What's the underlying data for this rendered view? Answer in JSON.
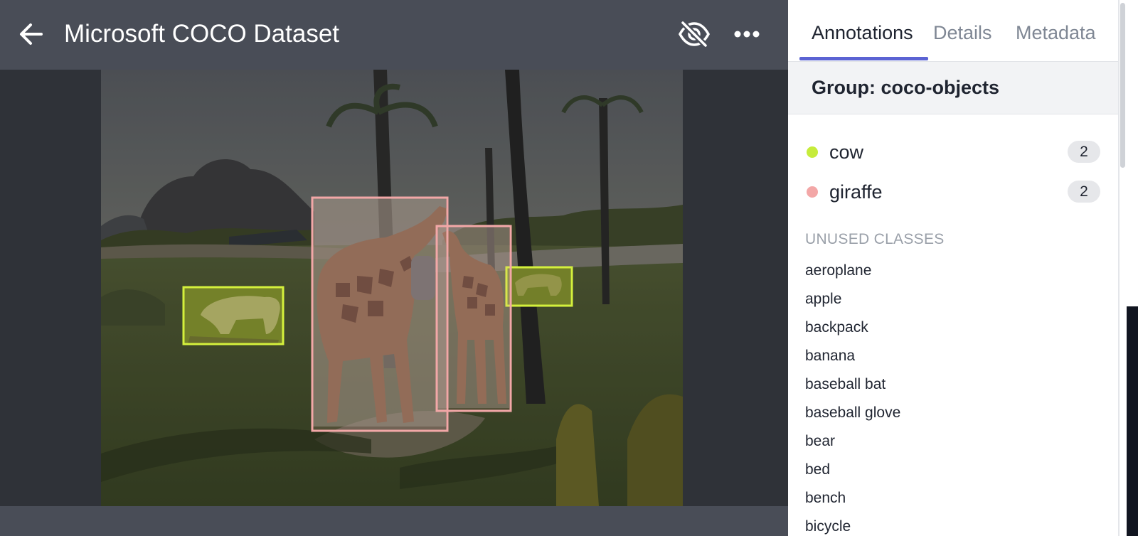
{
  "header": {
    "title": "Microsoft COCO Dataset",
    "back_icon": "arrow-left-icon",
    "visibility_icon": "eye-off-icon",
    "more_icon": "more-horizontal-icon"
  },
  "viewer": {
    "annotations": [
      {
        "class": "cow",
        "color": "#d4f03c"
      },
      {
        "class": "cow",
        "color": "#d4f03c"
      },
      {
        "class": "giraffe",
        "color": "#f2a7a7"
      },
      {
        "class": "giraffe",
        "color": "#f2a7a7"
      }
    ]
  },
  "panel": {
    "tabs": [
      {
        "label": "Annotations",
        "active": true
      },
      {
        "label": "Details",
        "active": false
      },
      {
        "label": "Metadata",
        "active": false
      }
    ],
    "group_title": "Group: coco-objects",
    "classes": [
      {
        "name": "cow",
        "count": "2",
        "color": "#c6ec3b"
      },
      {
        "name": "giraffe",
        "count": "2",
        "color": "#f3a7a7"
      }
    ],
    "unused_heading": "UNUSED CLASSES",
    "unused_classes": [
      "aeroplane",
      "apple",
      "backpack",
      "banana",
      "baseball bat",
      "baseball glove",
      "bear",
      "bed",
      "bench",
      "bicycle"
    ]
  },
  "colors": {
    "topbar": "#494d57",
    "viewer_bg": "#2f3238",
    "tab_accent": "#5b63d3"
  }
}
